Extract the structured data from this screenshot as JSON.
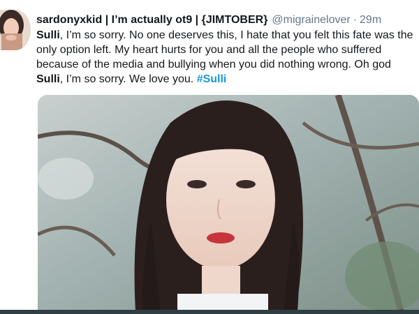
{
  "tweet": {
    "display_name": "sardonyxkid | I’m actually ot9 | {JIMTOBER}",
    "handle": "@migrainelover",
    "separator": "·",
    "time": "29m",
    "body": {
      "p1_bold": "Sulli",
      "p1": ", I’m so sorry. No one deserves this, I hate that you felt this fate was the only option left. My heart hurts for you and all the people who suffered because of the media and bullying when you did nothing wrong. Oh god ",
      "p2_bold": "Sulli",
      "p2": ", I’m so sorry. We love you. ",
      "hashtag": "#Sulli"
    }
  },
  "colors": {
    "text": "#14171a",
    "muted": "#657786",
    "link": "#1b95e0"
  },
  "icons": {
    "avatar": "profile-photo"
  }
}
